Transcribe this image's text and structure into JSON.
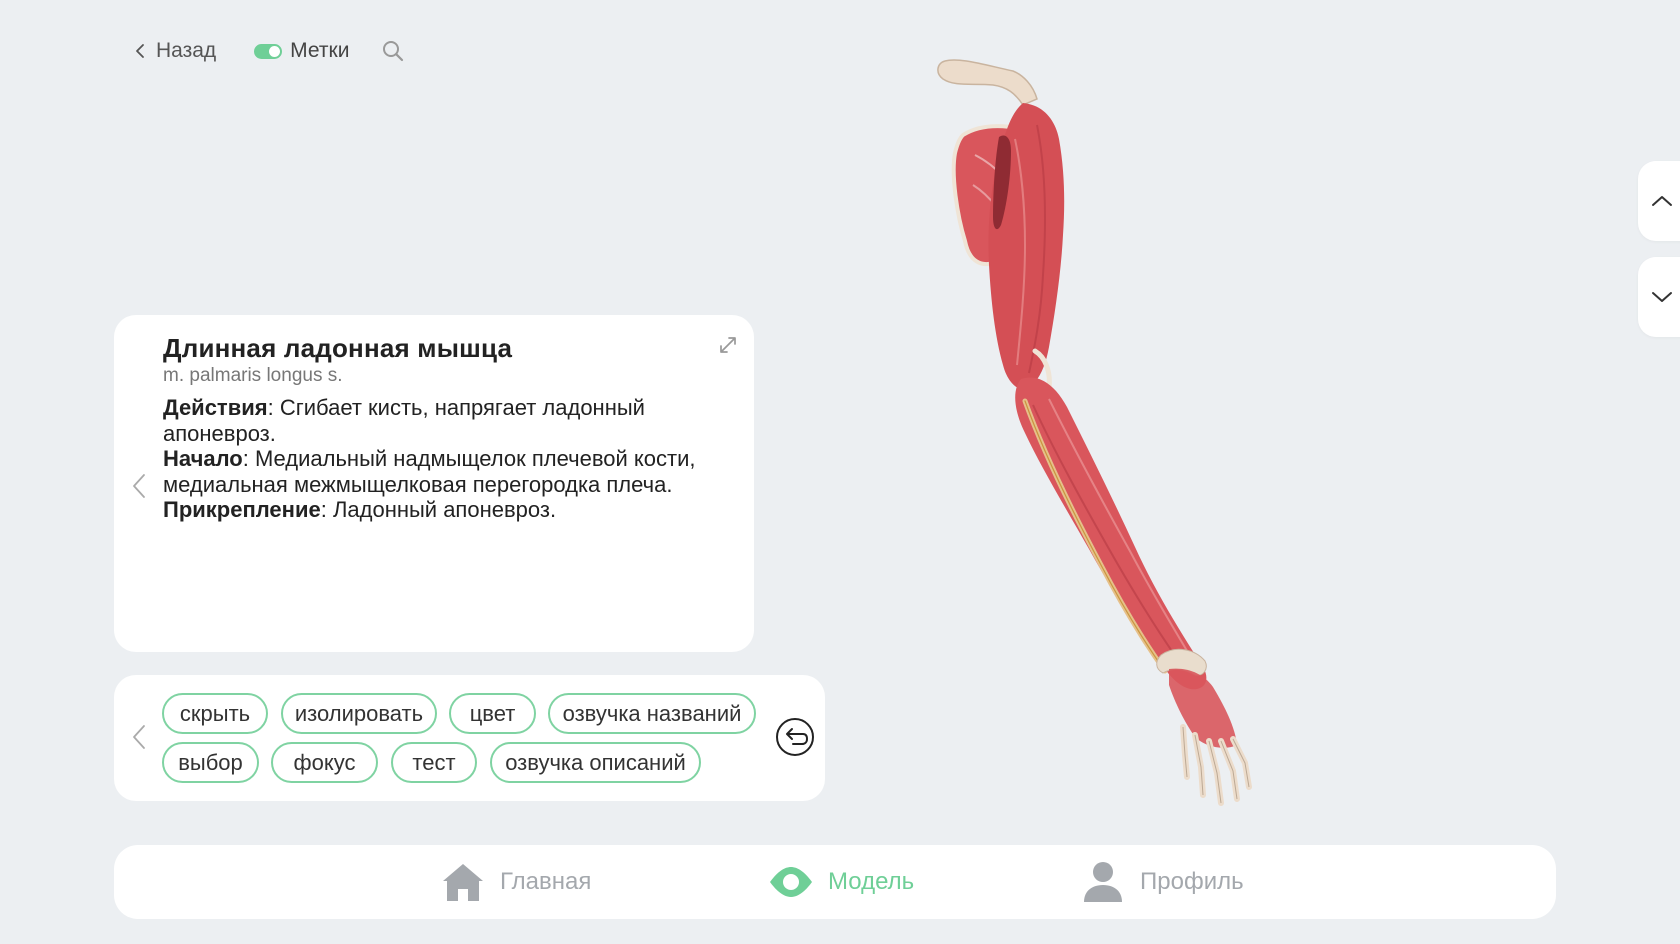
{
  "topbar": {
    "back_label": "Назад",
    "labels_label": "Метки",
    "labels_enabled": true
  },
  "info": {
    "title": "Длинная ладонная мышца",
    "latin": "m. palmaris longus s.",
    "actions_label": "Действия",
    "actions_text": ": Сгибает кисть, напрягает ладонный апоневроз.",
    "origin_label": "Начало",
    "origin_text": ": Медиальный надмыщелок плечевой кости, медиальная межмыщелковая перегородка плеча.",
    "insertion_label": "Прикрепление",
    "insertion_text": ": Ладонный апоневроз."
  },
  "actions": {
    "hide": "скрыть",
    "isolate": "изолировать",
    "color": "цвет",
    "voice_names": "озвучка названий",
    "select": "выбор",
    "focus": "фокус",
    "test": "тест",
    "voice_descriptions": "озвучка описаний"
  },
  "nav": {
    "home": "Главная",
    "model": "Модель",
    "profile": "Профиль",
    "active": "model"
  },
  "colors": {
    "accent": "#6fcf97",
    "chip_border": "#7fd3a2",
    "background": "#eceff2",
    "muscle": "#d9565c",
    "bone": "#ecdccb",
    "inactive": "#a4a8ad"
  }
}
